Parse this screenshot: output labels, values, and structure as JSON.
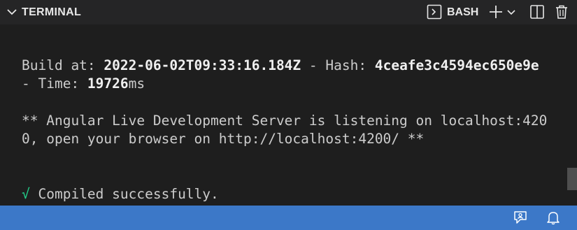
{
  "header": {
    "title": "TERMINAL",
    "shell": "BASH",
    "icons": [
      "chevron-down-icon",
      "terminal-icon",
      "plus-icon",
      "dropdown-chevron-icon",
      "split-icon",
      "trash-icon"
    ]
  },
  "terminal": {
    "line1": {
      "p1": "Build at: ",
      "date": "2022-06-02T09:33:16.184Z",
      "p2": " - Hash: ",
      "hash": "4ceafe3c4594ec650e9e"
    },
    "line2": {
      "p1": "- Time: ",
      "time": "19726",
      "unit": "ms"
    },
    "line3": "** Angular Live Development Server is listening on localhost:420",
    "line4": "0, open your browser on http://localhost:4200/ **",
    "line5": {
      "check": "√",
      "text": " Compiled successfully."
    }
  },
  "statusbar": {
    "icons": [
      "feedback-icon",
      "bell-icon"
    ]
  },
  "colors": {
    "header_bg": "#252526",
    "terminal_bg": "#1e1e1e",
    "statusbar_bg": "#3c78c8",
    "success": "#23d18b"
  }
}
